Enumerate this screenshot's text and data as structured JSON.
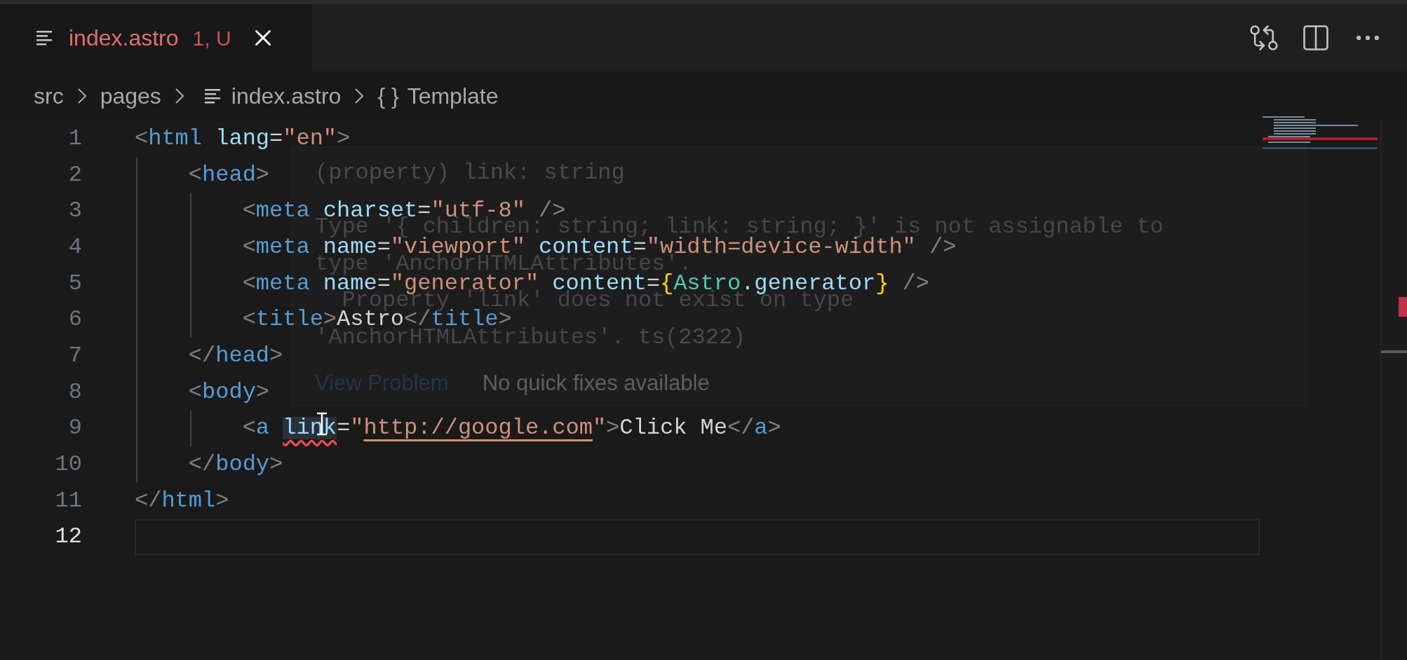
{
  "tab": {
    "label": "index.astro",
    "badge": "1, U",
    "selected": true,
    "has_error": true
  },
  "toolbar": [
    {
      "kind": "compare"
    },
    {
      "kind": "split"
    },
    {
      "kind": "more"
    }
  ],
  "breadcrumbs": [
    {
      "label": "src",
      "kind": "folder"
    },
    {
      "label": "pages",
      "kind": "folder"
    },
    {
      "label": "index.astro",
      "kind": "file"
    },
    {
      "label": "Template",
      "kind": "symbol",
      "symbol": "{ }"
    }
  ],
  "lines": [
    {
      "number": "1",
      "current": false,
      "tokens": [
        {
          "text": "<",
          "kind": "punct"
        },
        {
          "text": "html",
          "kind": "tag"
        },
        {
          "text": " lang",
          "kind": "attr"
        },
        {
          "text": "=",
          "kind": "text"
        },
        {
          "text": "\"en\"",
          "kind": "string"
        },
        {
          "text": ">",
          "kind": "punct"
        }
      ]
    },
    {
      "number": "2",
      "current": false,
      "tokens": [
        {
          "text": "    <",
          "kind": "punct"
        },
        {
          "text": "head",
          "kind": "tag"
        },
        {
          "text": ">",
          "kind": "punct"
        }
      ]
    },
    {
      "number": "3",
      "current": false,
      "tokens": [
        {
          "text": "        <",
          "kind": "punct"
        },
        {
          "text": "meta",
          "kind": "tag"
        },
        {
          "text": " charset",
          "kind": "attr"
        },
        {
          "text": "=",
          "kind": "text"
        },
        {
          "text": "\"utf-8\"",
          "kind": "string"
        },
        {
          "text": " />",
          "kind": "punct"
        }
      ]
    },
    {
      "number": "4",
      "current": false,
      "tokens": [
        {
          "text": "        <",
          "kind": "punct"
        },
        {
          "text": "meta",
          "kind": "tag"
        },
        {
          "text": " name",
          "kind": "attr"
        },
        {
          "text": "=",
          "kind": "text"
        },
        {
          "text": "\"viewport\"",
          "kind": "string"
        },
        {
          "text": " content",
          "kind": "attr"
        },
        {
          "text": "=",
          "kind": "text"
        },
        {
          "text": "\"width=device-width\"",
          "kind": "string"
        },
        {
          "text": " />",
          "kind": "punct"
        }
      ]
    },
    {
      "number": "5",
      "current": false,
      "tokens": [
        {
          "text": "        <",
          "kind": "punct"
        },
        {
          "text": "meta",
          "kind": "tag"
        },
        {
          "text": " name",
          "kind": "attr"
        },
        {
          "text": "=",
          "kind": "text"
        },
        {
          "text": "\"generator\"",
          "kind": "string"
        },
        {
          "text": " content",
          "kind": "attr"
        },
        {
          "text": "=",
          "kind": "text"
        },
        {
          "text": "{",
          "kind": "brace"
        },
        {
          "text": "Astro",
          "kind": "component"
        },
        {
          "text": ".generator",
          "kind": "attr"
        },
        {
          "text": "}",
          "kind": "brace"
        },
        {
          "text": " />",
          "kind": "punct"
        }
      ]
    },
    {
      "number": "6",
      "current": false,
      "tokens": [
        {
          "text": "        <",
          "kind": "punct"
        },
        {
          "text": "title",
          "kind": "tag"
        },
        {
          "text": ">",
          "kind": "punct"
        },
        {
          "text": "Astro",
          "kind": "text"
        },
        {
          "text": "</",
          "kind": "punct"
        },
        {
          "text": "title",
          "kind": "tag"
        },
        {
          "text": ">",
          "kind": "punct"
        }
      ]
    },
    {
      "number": "7",
      "current": false,
      "tokens": [
        {
          "text": "    </",
          "kind": "punct"
        },
        {
          "text": "head",
          "kind": "tag"
        },
        {
          "text": ">",
          "kind": "punct"
        }
      ]
    },
    {
      "number": "8",
      "current": false,
      "tokens": [
        {
          "text": "    <",
          "kind": "punct"
        },
        {
          "text": "body",
          "kind": "tag"
        },
        {
          "text": ">",
          "kind": "punct"
        }
      ]
    },
    {
      "number": "9",
      "current": false,
      "tokens": [
        {
          "text": "        <",
          "kind": "punct"
        },
        {
          "text": "a ",
          "kind": "tag"
        },
        {
          "text": "link",
          "kind": "error"
        },
        {
          "text": "=",
          "kind": "text"
        },
        {
          "text": "\"",
          "kind": "string"
        },
        {
          "text": "http://google.com",
          "kind": "url"
        },
        {
          "text": "\"",
          "kind": "string"
        },
        {
          "text": ">",
          "kind": "punct"
        },
        {
          "text": "Click Me",
          "kind": "text"
        },
        {
          "text": "</",
          "kind": "punct"
        },
        {
          "text": "a",
          "kind": "tag"
        },
        {
          "text": ">",
          "kind": "punct"
        }
      ]
    },
    {
      "number": "10",
      "current": false,
      "tokens": [
        {
          "text": "    </",
          "kind": "punct"
        },
        {
          "text": "body",
          "kind": "tag"
        },
        {
          "text": ">",
          "kind": "punct"
        }
      ]
    },
    {
      "number": "11",
      "current": false,
      "tokens": [
        {
          "text": "</",
          "kind": "punct"
        },
        {
          "text": "html",
          "kind": "tag"
        },
        {
          "text": ">",
          "kind": "punct"
        }
      ]
    },
    {
      "number": "12",
      "current": true
    }
  ],
  "hover": {
    "signature": "(property) link: string",
    "message": [
      "Type '{ children: string; link: string; }' is not assignable to",
      "type 'AnchorHTMLAttributes'.",
      "  Property 'link' does not exist on type",
      "'AnchorHTMLAttributes'."
    ],
    "code": "ts(2322)",
    "actions": [
      {
        "label": "View Problem",
        "kind": "link"
      },
      {
        "label": "No quick fixes available",
        "kind": "note"
      }
    ]
  }
}
